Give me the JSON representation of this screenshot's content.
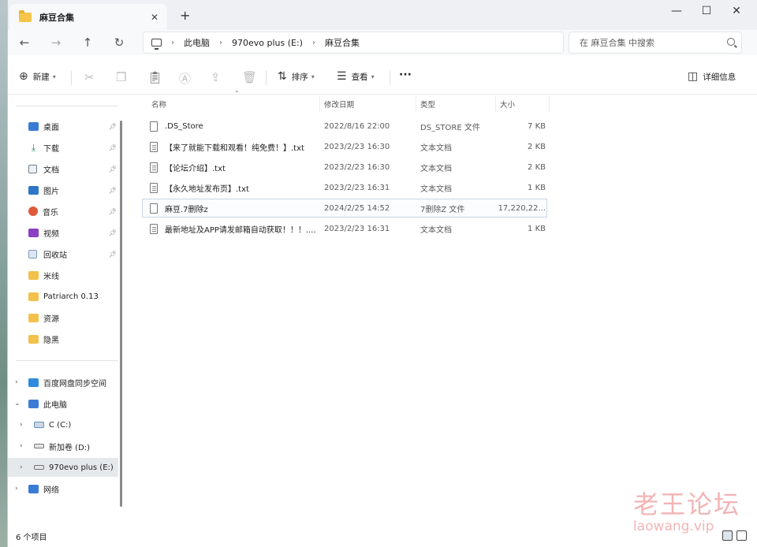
{
  "window": {
    "tab_title": "麻豆合集",
    "tab_close": "✕",
    "new_tab": "+",
    "minimize": "—",
    "maximize": "☐",
    "close": "✕"
  },
  "nav": {
    "back": "←",
    "forward": "→",
    "up": "↑",
    "refresh": "↻"
  },
  "breadcrumb": {
    "items": [
      "此电脑",
      "970evo plus (E:)",
      "麻豆合集"
    ],
    "separator": "›"
  },
  "search": {
    "placeholder": "在 麻豆合集 中搜索"
  },
  "toolbar": {
    "new_label": "新建",
    "sort_label": "排序",
    "view_label": "查看",
    "more_label": "···",
    "details_label": "详细信息"
  },
  "sidebar": {
    "quick_access": [
      {
        "label": "桌面",
        "icon": "desktop-icon",
        "color": "#3a7bd5"
      },
      {
        "label": "下载",
        "icon": "download-icon",
        "color": "#2a8a6a"
      },
      {
        "label": "文档",
        "icon": "documents-icon",
        "color": "#6d7c8a"
      },
      {
        "label": "图片",
        "icon": "pictures-icon",
        "color": "#2e76c8"
      },
      {
        "label": "音乐",
        "icon": "music-icon",
        "color": "#e0593a"
      },
      {
        "label": "视频",
        "icon": "videos-icon",
        "color": "#8a3fc4"
      },
      {
        "label": "回收站",
        "icon": "recycle-bin-icon",
        "color": "#7b9ac0"
      },
      {
        "label": "米线",
        "icon": "folder-icon",
        "color": "#f2c14b"
      },
      {
        "label": "Patriarch 0.13",
        "icon": "folder-icon",
        "color": "#f2c14b"
      },
      {
        "label": "资源",
        "icon": "folder-icon",
        "color": "#f2c14b"
      },
      {
        "label": "隐黑",
        "icon": "folder-icon",
        "color": "#f2c14b"
      }
    ],
    "tree": [
      {
        "label": "百度网盘同步空间",
        "icon": "cloud-sync-icon",
        "color": "#2f8ae0"
      },
      {
        "label": "此电脑",
        "icon": "this-pc-icon",
        "color": "#3a7bd5"
      },
      {
        "label": "C (C:)",
        "icon": "drive-icon",
        "color": "#5d8fc4"
      },
      {
        "label": "新加卷 (D:)",
        "icon": "drive-icon",
        "color": "#777777"
      },
      {
        "label": "970evo plus (E:)",
        "icon": "drive-icon",
        "color": "#777777"
      },
      {
        "label": "网络",
        "icon": "network-icon",
        "color": "#3a7bd5"
      }
    ]
  },
  "columns": {
    "name": "名称",
    "date": "修改日期",
    "type": "类型",
    "size": "大小"
  },
  "files": [
    {
      "name": ".DS_Store",
      "date": "2022/8/16 22:00",
      "type": "DS_STORE 文件",
      "size": "7 KB"
    },
    {
      "name": "【来了就能下载和观看！纯免费！】.txt",
      "date": "2023/2/23 16:30",
      "type": "文本文档",
      "size": "2 KB"
    },
    {
      "name": "【论坛介绍】.txt",
      "date": "2023/2/23 16:30",
      "type": "文本文档",
      "size": "2 KB"
    },
    {
      "name": "【永久地址发布页】.txt",
      "date": "2023/2/23 16:31",
      "type": "文本文档",
      "size": "1 KB"
    },
    {
      "name": "麻豆.7删除z",
      "date": "2024/2/25 14:52",
      "type": "7删除Z 文件",
      "size": "17,220,22..."
    },
    {
      "name": "最新地址及APP请发邮箱自动获取！！！....",
      "date": "2023/2/23 16:31",
      "type": "文本文档",
      "size": "1 KB"
    }
  ],
  "status": {
    "item_count": "6 个项目"
  },
  "watermark": {
    "title": "老王论坛",
    "url": "laowang.vip"
  }
}
